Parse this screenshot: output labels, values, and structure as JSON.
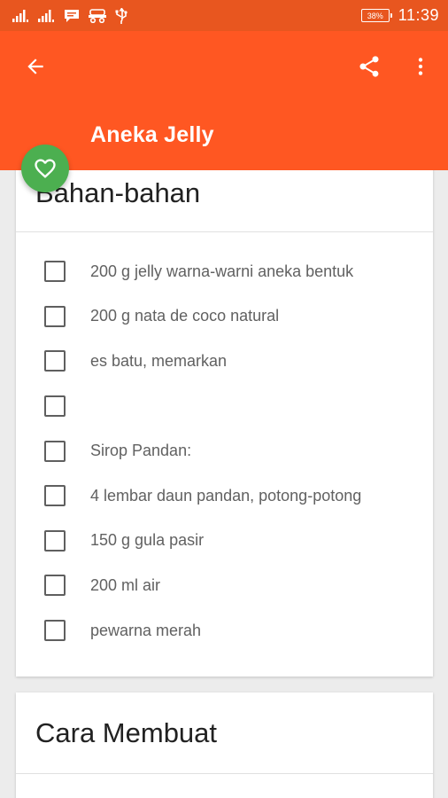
{
  "status_bar": {
    "time": "11:39",
    "battery_level": "38%",
    "icons": [
      "signal-icon",
      "signal-icon",
      "message-icon",
      "game-controller-icon",
      "usb-icon"
    ]
  },
  "app_bar": {
    "title": "Aneka Jelly",
    "back_icon": "arrow-back-icon",
    "share_icon": "share-icon",
    "more_icon": "more-vert-icon",
    "color": "#ff5722"
  },
  "favorite": {
    "icon": "heart-outline-icon",
    "color": "#4caf50"
  },
  "ingredients_card": {
    "title": "Bahan-bahan",
    "items": [
      {
        "label": "200 g jelly warna-warni aneka bentuk",
        "checked": false
      },
      {
        "label": "200 g nata de coco natural",
        "checked": false
      },
      {
        "label": "es batu, memarkan",
        "checked": false
      },
      {
        "label": "",
        "checked": false
      },
      {
        "label": "Sirop Pandan:",
        "checked": false
      },
      {
        "label": "4 lembar daun pandan, potong-potong",
        "checked": false
      },
      {
        "label": "150 g gula pasir",
        "checked": false
      },
      {
        "label": "200 ml air",
        "checked": false
      },
      {
        "label": "pewarna merah",
        "checked": false
      }
    ]
  },
  "steps_card": {
    "title": "Cara Membuat"
  }
}
